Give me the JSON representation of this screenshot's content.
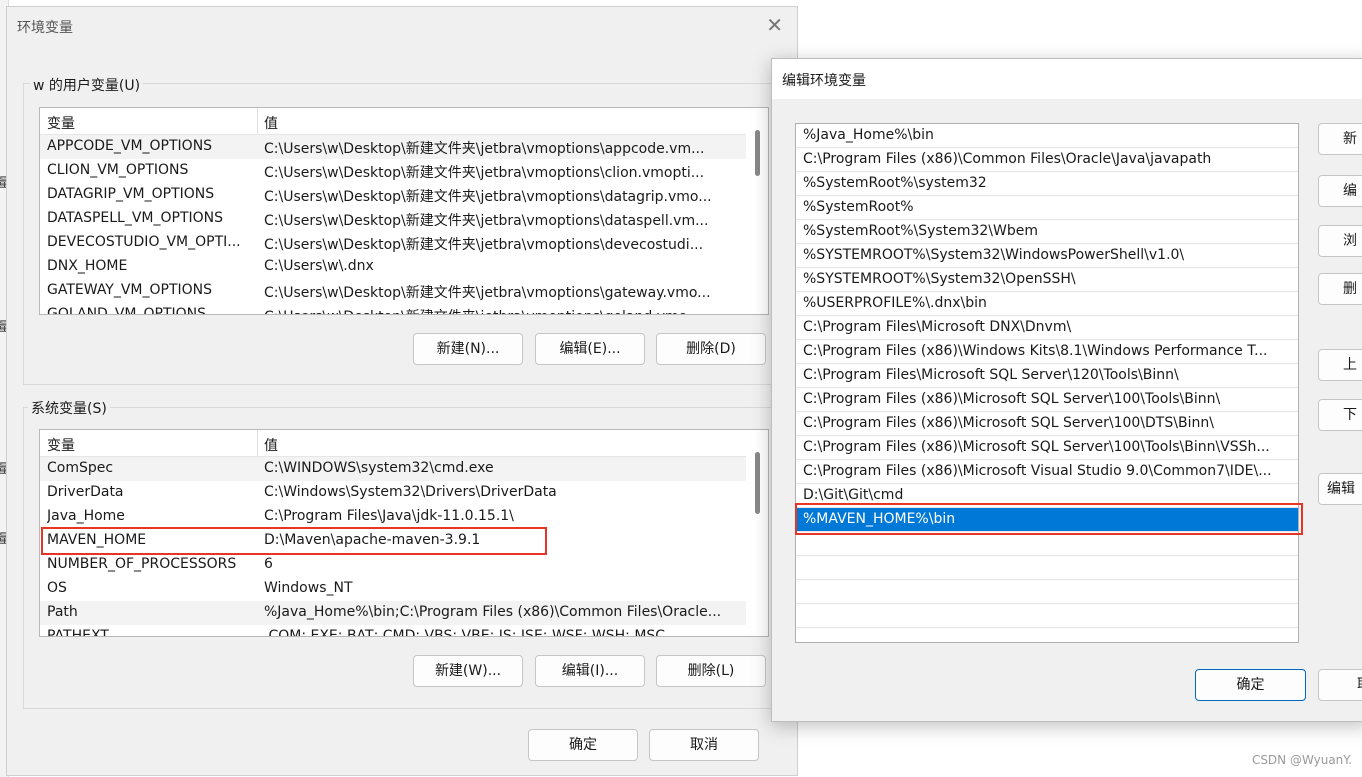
{
  "env_dialog": {
    "title": "环境变量",
    "user_group_label": "w 的用户变量(U)",
    "system_group_label": "系统变量(S)",
    "col_var": "变量",
    "col_val": "值",
    "user_vars": [
      {
        "name": "APPCODE_VM_OPTIONS",
        "value": "C:\\Users\\w\\Desktop\\新建文件夹\\jetbra\\vmoptions\\appcode.vm..."
      },
      {
        "name": "CLION_VM_OPTIONS",
        "value": "C:\\Users\\w\\Desktop\\新建文件夹\\jetbra\\vmoptions\\clion.vmopti..."
      },
      {
        "name": "DATAGRIP_VM_OPTIONS",
        "value": "C:\\Users\\w\\Desktop\\新建文件夹\\jetbra\\vmoptions\\datagrip.vmo..."
      },
      {
        "name": "DATASPELL_VM_OPTIONS",
        "value": "C:\\Users\\w\\Desktop\\新建文件夹\\jetbra\\vmoptions\\dataspell.vm..."
      },
      {
        "name": "DEVECOSTUDIO_VM_OPTI...",
        "value": "C:\\Users\\w\\Desktop\\新建文件夹\\jetbra\\vmoptions\\devecostudi..."
      },
      {
        "name": "DNX_HOME",
        "value": "C:\\Users\\w\\.dnx"
      },
      {
        "name": "GATEWAY_VM_OPTIONS",
        "value": "C:\\Users\\w\\Desktop\\新建文件夹\\jetbra\\vmoptions\\gateway.vmo..."
      },
      {
        "name": "GOLAND_VM_OPTIONS",
        "value": "C:\\Users\\w\\Desktop\\新建文件夹\\jetbra\\vmoptions\\goland.vmo..."
      }
    ],
    "user_buttons": {
      "new": "新建(N)...",
      "edit": "编辑(E)...",
      "delete": "删除(D)"
    },
    "system_vars": [
      {
        "name": "ComSpec",
        "value": "C:\\WINDOWS\\system32\\cmd.exe"
      },
      {
        "name": "DriverData",
        "value": "C:\\Windows\\System32\\Drivers\\DriverData"
      },
      {
        "name": "Java_Home",
        "value": "C:\\Program Files\\Java\\jdk-11.0.15.1\\"
      },
      {
        "name": "MAVEN_HOME",
        "value": "D:\\Maven\\apache-maven-3.9.1"
      },
      {
        "name": "NUMBER_OF_PROCESSORS",
        "value": "6"
      },
      {
        "name": "OS",
        "value": "Windows_NT"
      },
      {
        "name": "Path",
        "value": "%Java_Home%\\bin;C:\\Program Files (x86)\\Common Files\\Oracle..."
      },
      {
        "name": "PATHEXT",
        "value": ".COM;.EXE;.BAT;.CMD;.VBS;.VBE;.JS;.JSE;.WSF;.WSH;.MSC"
      }
    ],
    "system_buttons": {
      "new": "新建(W)...",
      "edit": "编辑(I)...",
      "delete": "删除(L)"
    },
    "ok": "确定",
    "cancel": "取消"
  },
  "edit_dialog": {
    "title": "编辑环境变量",
    "paths": [
      "%Java_Home%\\bin",
      "C:\\Program Files (x86)\\Common Files\\Oracle\\Java\\javapath",
      "%SystemRoot%\\system32",
      "%SystemRoot%",
      "%SystemRoot%\\System32\\Wbem",
      "%SYSTEMROOT%\\System32\\WindowsPowerShell\\v1.0\\",
      "%SYSTEMROOT%\\System32\\OpenSSH\\",
      "%USERPROFILE%\\.dnx\\bin",
      "C:\\Program Files\\Microsoft DNX\\Dnvm\\",
      "C:\\Program Files (x86)\\Windows Kits\\8.1\\Windows Performance T...",
      "C:\\Program Files\\Microsoft SQL Server\\120\\Tools\\Binn\\",
      "C:\\Program Files (x86)\\Microsoft SQL Server\\100\\Tools\\Binn\\",
      "C:\\Program Files (x86)\\Microsoft SQL Server\\100\\DTS\\Binn\\",
      "C:\\Program Files (x86)\\Microsoft SQL Server\\100\\Tools\\Binn\\VSSh...",
      "C:\\Program Files (x86)\\Microsoft Visual Studio 9.0\\Common7\\IDE\\...",
      "D:\\Git\\Git\\cmd",
      "%MAVEN_HOME%\\bin"
    ],
    "selected_path": "%MAVEN_HOME%\\bin",
    "side_buttons": [
      "新",
      "编",
      "浏",
      "删",
      "上",
      "下",
      "编辑"
    ],
    "ok": "确定",
    "cancel": "取"
  },
  "background_glyphs": [
    "量",
    "量",
    "量",
    "量"
  ],
  "watermark": "CSDN @WyuanY.",
  "colors": {
    "selection": "#0078d7",
    "highlight_box": "#e53526"
  }
}
